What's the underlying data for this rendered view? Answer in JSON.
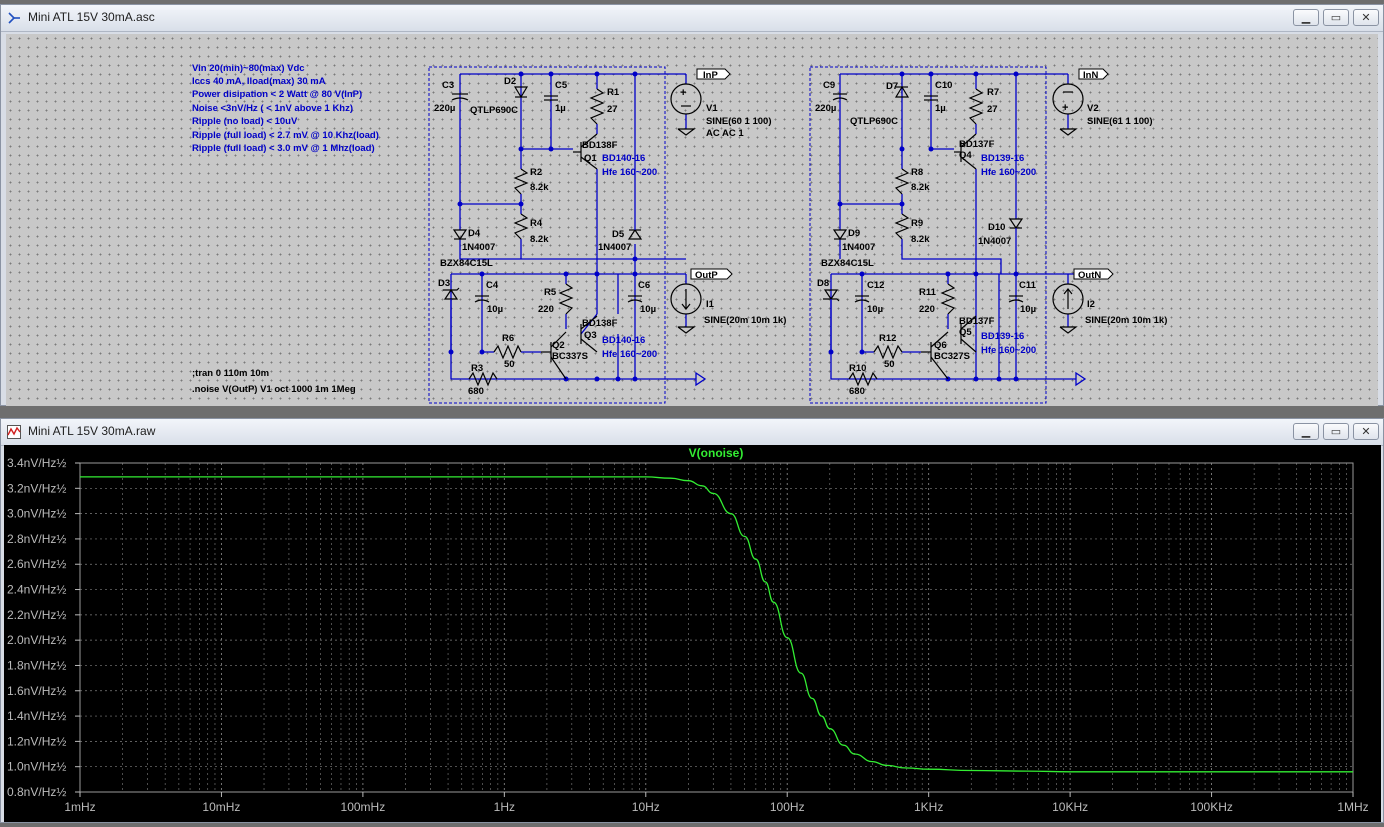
{
  "schematic_window": {
    "title": "Mini ATL 15V 30mA.asc",
    "buttons": [
      "minimize",
      "maximize",
      "close"
    ],
    "notes": [
      "Vin 20(min)~80(max) Vdc",
      "Iccs 40 mA, Iload(max) 30 mA",
      "Power disipation < 2 Watt @ 80 V(InP)",
      "Noise <3nV/Hz ( < 1nV above 1 Khz)",
      "Ripple (no load) < 10uV",
      "Ripple (full load) < 2.7 mV @ 10 Khz(load)",
      "Ripple (full load) < 3.0 mV @ 1 Mhz(load)"
    ],
    "directives": [
      ";tran 0 110m 10m",
      ".noise V(OutP) V1 oct 1000 1m 1Meg"
    ],
    "net_labels": {
      "inp": "InP",
      "outp": "OutP",
      "inn": "InN",
      "outn": "OutN"
    },
    "left": {
      "C3": "C3",
      "C3v": "220µ",
      "D2": "D2",
      "D2v": "QTLP690C",
      "C5": "C5",
      "C5v": "1µ",
      "R1": "R1",
      "R1v": "27",
      "Q1t": "BD138F",
      "Q1": "Q1",
      "Q1p": "BD140-16",
      "Q1h": "Hfe 160~200",
      "R2": "R2",
      "R2v": "8.2k",
      "R4": "R4",
      "R4v": "8.2k",
      "D4": "D4",
      "D4v": "1N4007",
      "D5": "D5",
      "D5v": "1N4007",
      "D3v": "BZX84C15L",
      "D3": "D3",
      "C4": "C4",
      "C4v": "10µ",
      "R5": "R5",
      "R5v": "220",
      "Q3t": "BD138F",
      "Q3": "Q3",
      "Q3p": "BD140-16",
      "Q3h": "Hfe 160~200",
      "C6": "C6",
      "C6v": "10µ",
      "R6": "R6",
      "R6v": "50",
      "Q2": "Q2",
      "Q2v": "BC337S",
      "R3": "R3",
      "R3v": "680",
      "V1": "V1",
      "V1v": "SINE(60 1 100)",
      "V1ac": "AC AC 1",
      "I1": "I1",
      "I1v": "SINE(20m 10m 1k)"
    },
    "right": {
      "C9": "C9",
      "C9v": "220µ",
      "D7": "D7",
      "D7v": "QTLP690C",
      "C10": "C10",
      "C10v": "1µ",
      "R7": "R7",
      "R7v": "27",
      "Q4t": "BD137F",
      "Q4": "Q4",
      "Q4p": "BD139-16",
      "Q4h": "Hfe 160~200",
      "R8": "R8",
      "R8v": "8.2k",
      "R9": "R9",
      "R9v": "8.2k",
      "D9": "D9",
      "D9v": "1N4007",
      "D10": "D10",
      "D10v": "1N4007",
      "D8v": "BZX84C15L",
      "D8": "D8",
      "C12": "C12",
      "C12v": "10µ",
      "R11": "R11",
      "R11v": "220",
      "Q5t": "BD137F",
      "Q5": "Q5",
      "Q5p": "BD139-16",
      "Q5h": "Hfe 160~200",
      "C11": "C11",
      "C11v": "10µ",
      "R12": "R12",
      "R12v": "50",
      "Q6": "Q6",
      "Q6v": "BC327S",
      "R10": "R10",
      "R10v": "680",
      "V2": "V2",
      "V2v": "SINE(61 1 100)",
      "I2": "I2",
      "I2v": "SINE(20m 10m 1k)"
    }
  },
  "plot_window": {
    "title": "Mini ATL 15V 30mA.raw",
    "buttons": [
      "minimize",
      "maximize",
      "close"
    ]
  },
  "colors": {
    "trace": "#33ee33",
    "schematic_wire": "#0000c8",
    "plot_bg": "#000000",
    "grid": "#808080"
  },
  "chart_data": {
    "type": "line",
    "title": "V(onoise)",
    "x_scale": "log",
    "xlim": [
      0.001,
      1000000
    ],
    "ylim": [
      0.8,
      3.4
    ],
    "x_ticks": [
      "1mHz",
      "10mHz",
      "100mHz",
      "1Hz",
      "10Hz",
      "100Hz",
      "1KHz",
      "10KHz",
      "100KHz",
      "1MHz"
    ],
    "y_ticks": [
      "3.4nV/Hz½",
      "3.2nV/Hz½",
      "3.0nV/Hz½",
      "2.8nV/Hz½",
      "2.6nV/Hz½",
      "2.4nV/Hz½",
      "2.2nV/Hz½",
      "2.0nV/Hz½",
      "1.8nV/Hz½",
      "1.6nV/Hz½",
      "1.4nV/Hz½",
      "1.2nV/Hz½",
      "1.0nV/Hz½",
      "0.8nV/Hz½"
    ],
    "grid": true,
    "series": [
      {
        "name": "V(onoise)",
        "x": [
          0.001,
          0.01,
          0.1,
          1,
          5,
          10,
          15,
          20,
          25,
          30,
          40,
          50,
          60,
          70,
          80,
          100,
          125,
          150,
          175,
          200,
          250,
          300,
          400,
          500,
          700,
          1000,
          2000,
          5000,
          10000,
          100000,
          1000000
        ],
        "y": [
          3.29,
          3.29,
          3.29,
          3.29,
          3.29,
          3.29,
          3.28,
          3.26,
          3.22,
          3.16,
          3.0,
          2.82,
          2.64,
          2.46,
          2.3,
          2.02,
          1.74,
          1.54,
          1.4,
          1.3,
          1.17,
          1.1,
          1.04,
          1.01,
          0.99,
          0.98,
          0.97,
          0.965,
          0.96,
          0.96,
          0.96
        ]
      }
    ]
  }
}
